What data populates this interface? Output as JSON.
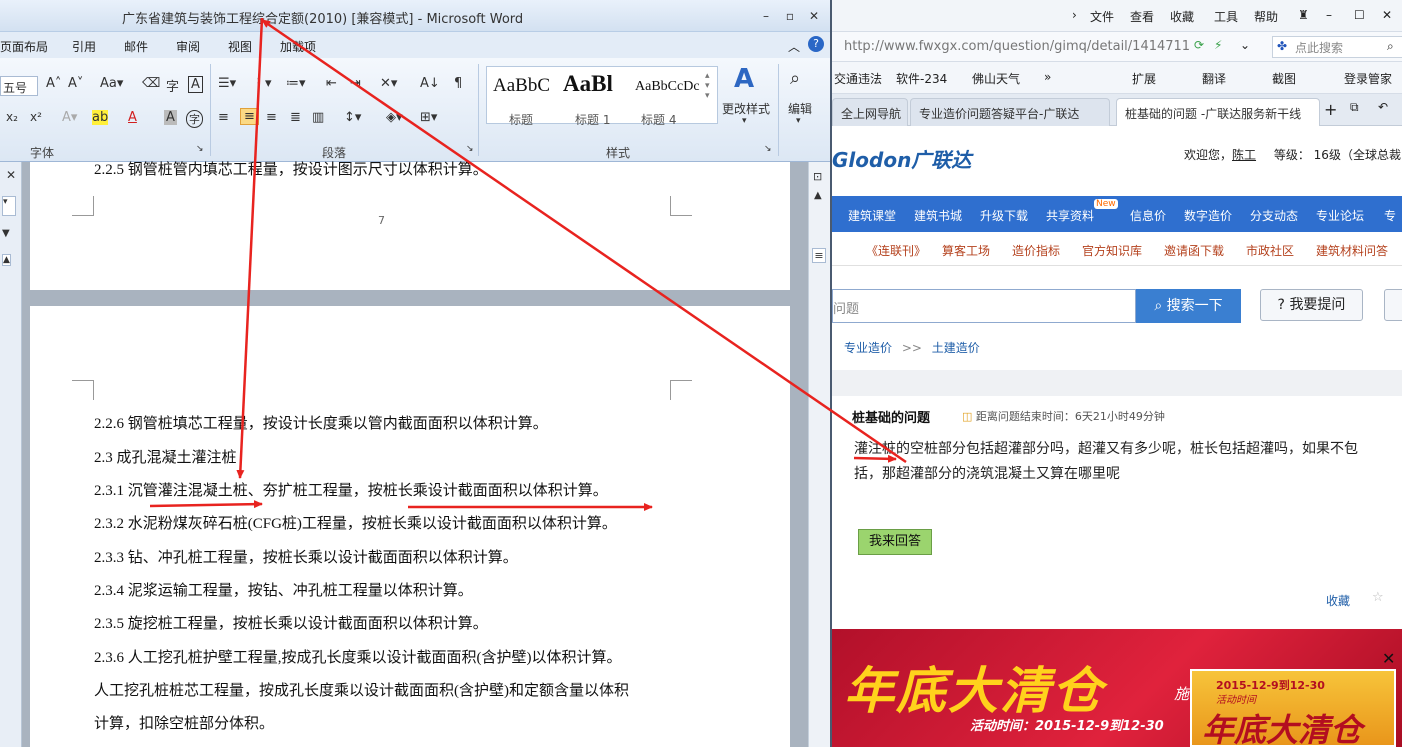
{
  "word": {
    "title": "广东省建筑与装饰工程综合定额(2010) [兼容模式] - Microsoft Word",
    "tabs": [
      "页面布局",
      "引用",
      "邮件",
      "审阅",
      "视图",
      "加载项"
    ],
    "font_size_value": "五号",
    "group_labels": {
      "font": "字体",
      "paragraph": "段落",
      "styles": "样式"
    },
    "styles": [
      {
        "sample": "AaBbC",
        "name": "标题"
      },
      {
        "sample": "AaBl",
        "name": "标题 1"
      },
      {
        "sample": "AaBbCcDc",
        "name": "标题 4"
      }
    ],
    "change_styles": "更改样式",
    "edit": "编辑",
    "page_number": "7",
    "page1_line": "2.2.5  钢管桩管内填芯工程量，按设计图示尺寸以体积计算。",
    "doc_lines": [
      "2.2.6  钢管桩填芯工程量，按设计长度乘以管内截面面积以体积计算。",
      "2.3  成孔混凝土灌注桩",
      "2.3.1  沉管灌注混凝土桩、夯扩桩工程量，按桩长乘设计截面面积以体积计算。",
      "2.3.2  水泥粉煤灰碎石桩(CFG桩)工程量，按桩长乘以设计截面面积以体积计算。",
      "2.3.3  钻、冲孔桩工程量，按桩长乘以设计截面面积以体积计算。",
      "2.3.4  泥浆运输工程量，按钻、冲孔桩工程量以体积计算。",
      "2.3.5  旋挖桩工程量，按桩长乘以设计截面面积以体积计算。",
      "2.3.6  人工挖孔桩护壁工程量,按成孔长度乘以设计截面面积(含护壁)以体积计算。",
      "人工挖孔桩桩芯工程量，按成孔长度乘以设计截面面积(含护壁)和定额含量以体积",
      "计算，扣除空桩部分体积。"
    ]
  },
  "browser": {
    "menu": [
      "文件",
      "查看",
      "收藏",
      "工具",
      "帮助"
    ],
    "url": "http://www.fwxgx.com/question/gimq/detail/1414711",
    "search_placeholder": "点此搜索",
    "bookmarks": [
      "交通违法",
      "软件-234",
      "佛山天气",
      "扩展",
      "翻译",
      "截图",
      "登录管家"
    ],
    "tabs": [
      "全上网导航",
      "专业造价问题答疑平台-广联达",
      "桩基础的问题 -广联达服务新干线"
    ],
    "logo": "Glodon广联达",
    "welcome_prefix": "欢迎您，",
    "username": "陈工",
    "level": "等级：  16级（全球总裁",
    "nav1": [
      "建筑课堂",
      "建筑书城",
      "升级下载",
      "共享资料",
      "信息价",
      "数字造价",
      "分支动态",
      "专业论坛",
      "专"
    ],
    "new_badge": "New",
    "nav2": [
      "《连联刊》",
      "算客工场",
      "造价指标",
      "官方知识库",
      "邀请函下载",
      "市政社区",
      "建筑材料问答"
    ],
    "search_placeholder_site": "问题",
    "search_button": "搜索一下",
    "ask_button": "我要提问",
    "breadcrumb": [
      "专业造价",
      "土建造价"
    ],
    "question_title": "桩基础的问题",
    "question_time_label": "距离问题结束时间：",
    "question_time": "6天21小时49分钟",
    "question_body": [
      "灌注桩的空桩部分包括超灌部分吗，超灌又有多少呢，桩长包括超灌吗，如果不包",
      "括，那超灌部分的浇筑混凝土又算在哪里呢"
    ],
    "answer_button": "我来回答",
    "collect": "收藏",
    "banner": {
      "big": "年底大清仓",
      "side": "施",
      "date": "活动时间：2015-12-9到12-30",
      "ad_date": "2015-12-9到12-30",
      "ad_sub": "活动时间",
      "ad_big": "年底大清仓"
    }
  },
  "colors": {
    "annotation_red": "#e8231f",
    "nav_blue": "#2f6fcf",
    "logo_blue": "#1f5ea8",
    "answer_green": "#9bd46e"
  }
}
